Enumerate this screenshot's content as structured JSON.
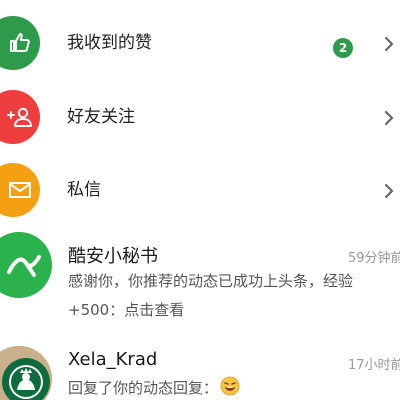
{
  "menu": {
    "likes": {
      "label": "我收到的赞",
      "badge": "2",
      "icon": "thumbs-up-icon",
      "color": "#2e9b4a",
      "badge_color": "#2e9b4a"
    },
    "follows": {
      "label": "好友关注",
      "icon": "add-friend-icon",
      "color": "#ee3d3d"
    },
    "messages": {
      "label": "私信",
      "icon": "mail-icon",
      "color": "#f5a012"
    }
  },
  "conversations": [
    {
      "name": "酷安小秘书",
      "time": "59分钟前",
      "message_line1": "感谢你，你推荐的动态已成功上头条，经验",
      "message_line2": "+500：点击查看",
      "avatar_icon": "coolapk-logo-icon",
      "avatar_color": "#2bb24c"
    },
    {
      "name": "Xela_Krad",
      "time": "17小时前",
      "message": "回复了你的动态回复：",
      "avatar_icon": "starbucks-avatar",
      "emoji_icon": "grinning-emoji-icon"
    }
  ]
}
